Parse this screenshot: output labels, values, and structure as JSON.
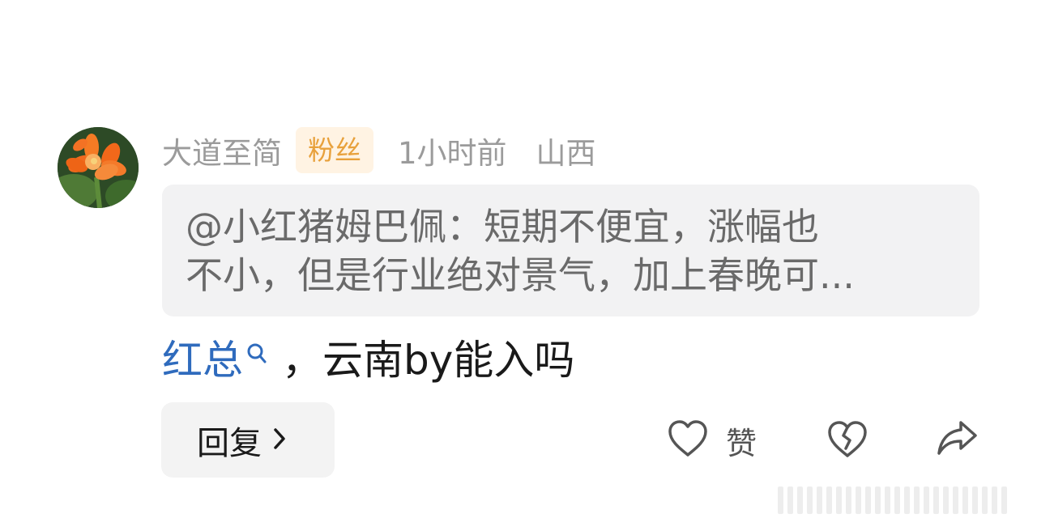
{
  "comment": {
    "author": "大道至简",
    "badge": "粉丝",
    "time": "1小时前",
    "region": "山西",
    "quote": {
      "line1": "@小红猪姆巴佩：短期不便宜，涨幅也",
      "line2": "不小，但是行业绝对景气，加上春晚可..."
    },
    "mention": "红总",
    "body": "，云南by能入吗"
  },
  "actions": {
    "reply_label": "回复",
    "like_label": "赞"
  },
  "icons": {
    "avatar": "flower-avatar",
    "mention": "search-icon",
    "reply": "chevron-right-icon",
    "like": "heart-icon",
    "dislike": "broken-heart-icon",
    "share": "share-arrow-icon"
  },
  "colors": {
    "mention": "#2f6bbd",
    "badge_text": "#e8a13c",
    "badge_bg": "#fff3e3",
    "meta": "#9b9b9b",
    "quote_bg": "#f2f2f3",
    "quote_text": "#6a6a6a",
    "button_bg": "#f3f3f3"
  }
}
